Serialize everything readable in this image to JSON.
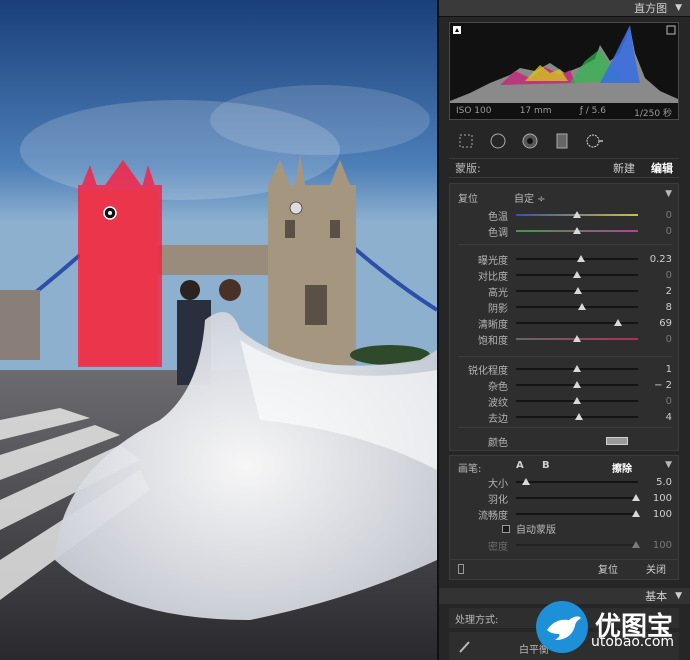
{
  "histogram": {
    "title": "直方图",
    "iso": "ISO 100",
    "focal": "17 mm",
    "aperture": "ƒ / 5.6",
    "shutter": "1/250 秒"
  },
  "mask": {
    "label": "蒙版:",
    "new": "新建",
    "edit": "编辑"
  },
  "adjust": {
    "reset": "复位",
    "preset": "自定 ÷",
    "rows": [
      {
        "label": "色温",
        "value": "0",
        "pos": 0.5
      },
      {
        "label": "色调",
        "value": "0",
        "pos": 0.5
      },
      {
        "label": "曝光度",
        "value": "0.23",
        "pos": 0.53
      },
      {
        "label": "对比度",
        "value": "0",
        "pos": 0.5
      },
      {
        "label": "高光",
        "value": "2",
        "pos": 0.51
      },
      {
        "label": "阴影",
        "value": "8",
        "pos": 0.54
      },
      {
        "label": "清晰度",
        "value": "69",
        "pos": 0.84
      },
      {
        "label": "饱和度",
        "value": "0",
        "pos": 0.5
      },
      {
        "label": "锐化程度",
        "value": "1",
        "pos": 0.5
      },
      {
        "label": "杂色",
        "value": "− 2",
        "pos": 0.5
      },
      {
        "label": "波纹",
        "value": "0",
        "pos": 0.5
      },
      {
        "label": "去边",
        "value": "4",
        "pos": 0.52
      }
    ],
    "color_label": "颜色"
  },
  "brush": {
    "label": "画笔:",
    "a": "A",
    "b": "B",
    "erase": "擦除",
    "size_label": "大小",
    "size_value": "5.0",
    "feather_label": "羽化",
    "feather_value": "100",
    "flow_label": "流畅度",
    "flow_value": "100",
    "automask_label": "自动蒙版",
    "density_label": "密度",
    "density_value": "100",
    "reset": "复位",
    "close": "关闭"
  },
  "basic": {
    "title": "基本",
    "process_label": "处理方式:",
    "wb_label": "白平衡"
  },
  "watermark": {
    "name": "优图宝",
    "url": "utobao.com"
  },
  "colors": {
    "accent": "#1e90d8",
    "mask_red": "#ff1a3c",
    "panel": "#262626"
  }
}
